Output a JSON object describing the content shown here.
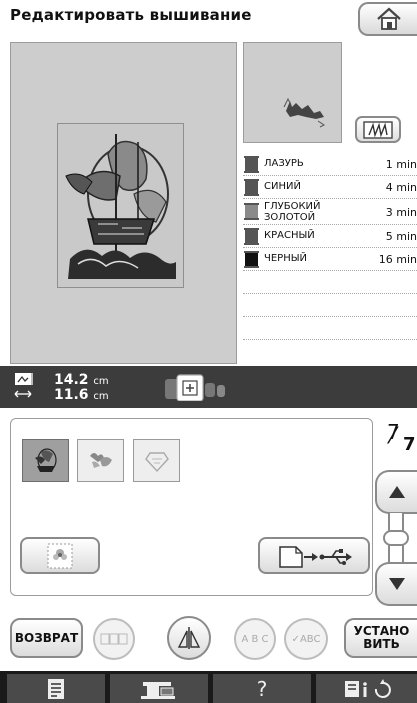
{
  "header": {
    "title": "Редактировать вышивание"
  },
  "colors": [
    {
      "name": "ЛАЗУРЬ",
      "time": "1 min",
      "color": "#555555"
    },
    {
      "name": "СИНИЙ",
      "time": "4 min",
      "color": "#555555"
    },
    {
      "name": "ГЛУБОКИЙ ЗОЛОТОЙ",
      "name_line1": "ГЛУБОКИЙ",
      "name_line2": "ЗОЛОТОЙ",
      "time": "3 min",
      "color": "#888888"
    },
    {
      "name": "КРАСНЫЙ",
      "time": "5 min",
      "color": "#555555"
    },
    {
      "name": "ЧЕРНЫЙ",
      "time": "16 min",
      "color": "#111111"
    }
  ],
  "size": {
    "height_value": "14.2",
    "width_value": "11.6",
    "unit": "cm"
  },
  "page": {
    "current": "7",
    "total": "7"
  },
  "actions": {
    "back_label": "ВОЗВРАТ",
    "set_label_line1": "УСТАНО",
    "set_label_line2": "ВИТЬ"
  },
  "round_buttons": {
    "text_arc_label": "A B C",
    "text_check_label": "ABC"
  },
  "bottom": {
    "help_label": "?"
  }
}
